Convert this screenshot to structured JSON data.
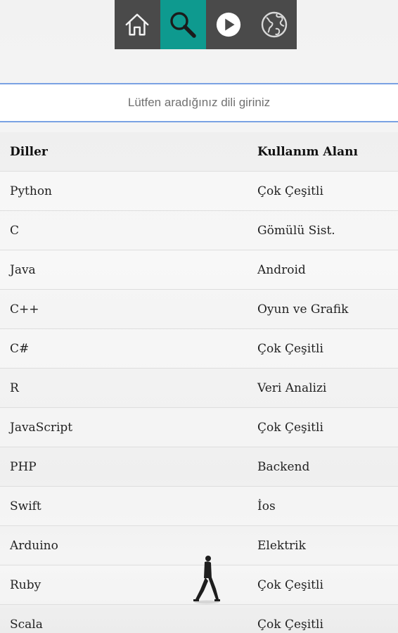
{
  "nav": {
    "items": [
      {
        "name": "home",
        "icon": "home-icon",
        "active": false
      },
      {
        "name": "search",
        "icon": "search-icon",
        "active": true
      },
      {
        "name": "play",
        "icon": "play-icon",
        "active": false
      },
      {
        "name": "globe",
        "icon": "globe-icon",
        "active": false
      }
    ],
    "colors": {
      "background": "#4a4a4a",
      "active": "#0e9a8f"
    }
  },
  "search": {
    "placeholder": "Lütfen aradığınız dili giriniz",
    "value": ""
  },
  "table": {
    "headers": [
      "Diller",
      "Kullanım Alanı"
    ],
    "rows": [
      [
        "Python",
        "Çok Çeşitli"
      ],
      [
        "C",
        "Gömülü Sist."
      ],
      [
        "Java",
        "Android"
      ],
      [
        "C++",
        "Oyun ve Grafik"
      ],
      [
        "C#",
        "Çok Çeşitli"
      ],
      [
        "R",
        "Veri Analizi"
      ],
      [
        "JavaScript",
        "Çok Çeşitli"
      ],
      [
        "PHP",
        "Backend"
      ],
      [
        "Swift",
        "İos"
      ],
      [
        "Arduino",
        "Elektrik"
      ],
      [
        "Ruby",
        "Çok Çeşitli"
      ],
      [
        "Scala",
        "Çok Çeşitli"
      ]
    ]
  }
}
